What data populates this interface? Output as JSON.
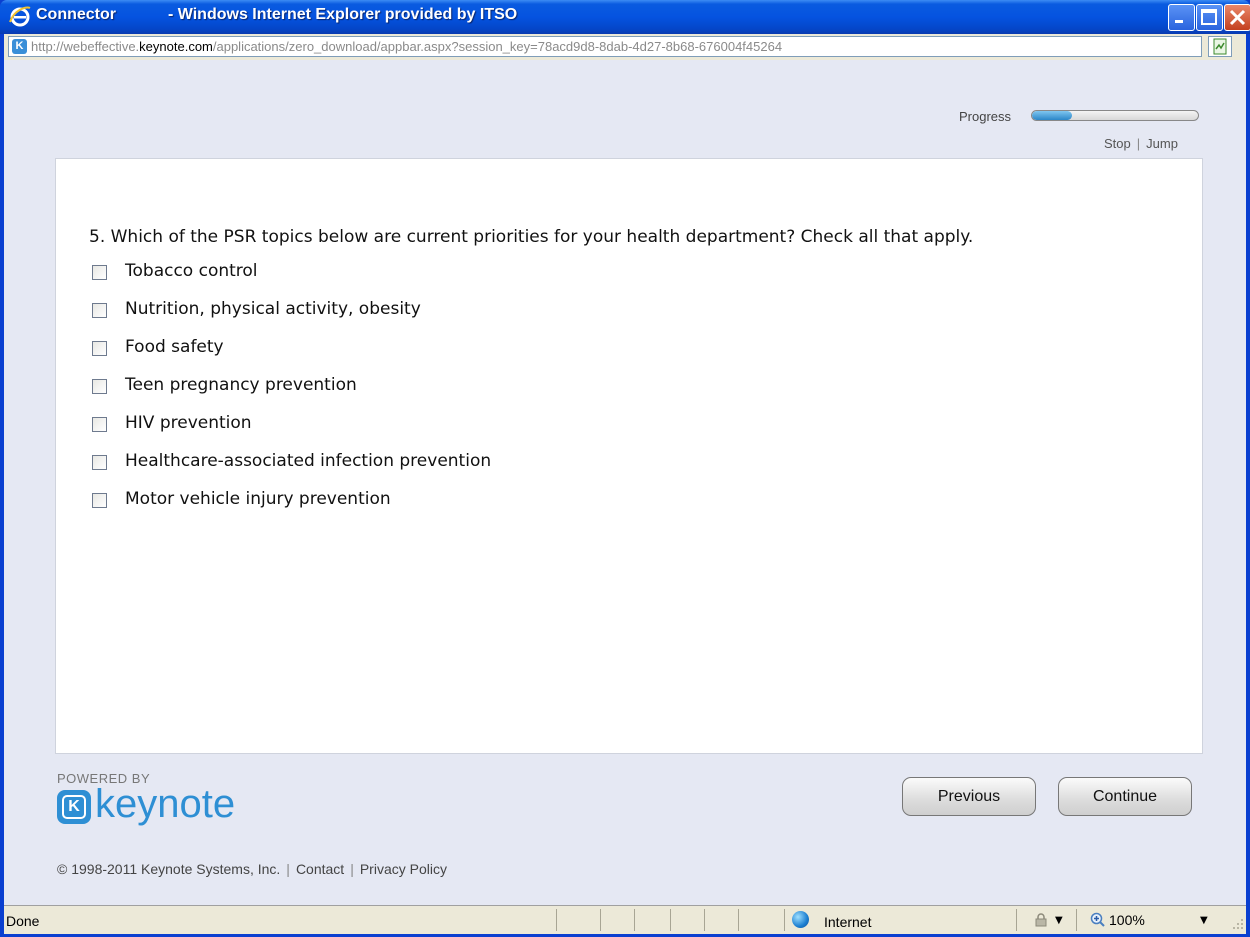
{
  "window": {
    "title_app": "Connector",
    "title_suffix": "- Windows Internet Explorer provided by ITSO"
  },
  "address": {
    "url_prefix": "http://webeffective.",
    "url_domain": "keynote.com",
    "url_path": "/applications/zero_download/appbar.aspx?session_key=78acd9d8-8dab-4d27-8b68-676004f45264"
  },
  "progress": {
    "label": "Progress",
    "fraction": 0.24,
    "stop_label": "Stop",
    "jump_label": "Jump"
  },
  "survey": {
    "question": "5. Which of the PSR topics below are current priorities for your health department? Check all that apply.",
    "options": [
      "Tobacco control",
      "Nutrition, physical activity, obesity",
      "Food safety",
      "Teen pregnancy prevention",
      "HIV prevention",
      "Healthcare-associated infection prevention",
      "Motor vehicle injury prevention"
    ]
  },
  "branding": {
    "powered_by": "POWERED BY",
    "wordmark": "keynote",
    "brand_color": "#2e8fd4"
  },
  "nav": {
    "previous_label": "Previous",
    "continue_label": "Continue"
  },
  "footer": {
    "copyright": "© 1998-2011 Keynote Systems, Inc.",
    "contact": "Contact",
    "privacy": "Privacy Policy"
  },
  "statusbar": {
    "status": "Done",
    "zone": "Internet",
    "zoom": "100%"
  }
}
